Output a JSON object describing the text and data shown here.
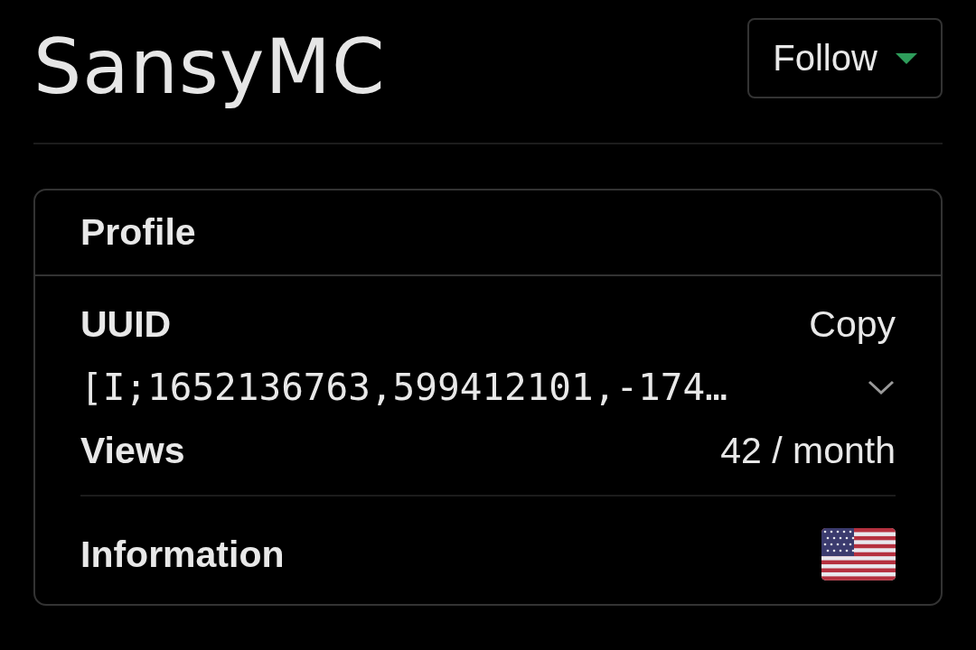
{
  "header": {
    "title": "SansyMC",
    "follow_button": {
      "label": "Follow"
    }
  },
  "profile_card": {
    "title": "Profile",
    "uuid": {
      "label": "UUID",
      "copy_link": "Copy",
      "value": "[I;1652136763,599412101,-174…",
      "expanded": false
    },
    "views": {
      "label": "Views",
      "value": "42 / month"
    },
    "information": {
      "label": "Information"
    }
  }
}
